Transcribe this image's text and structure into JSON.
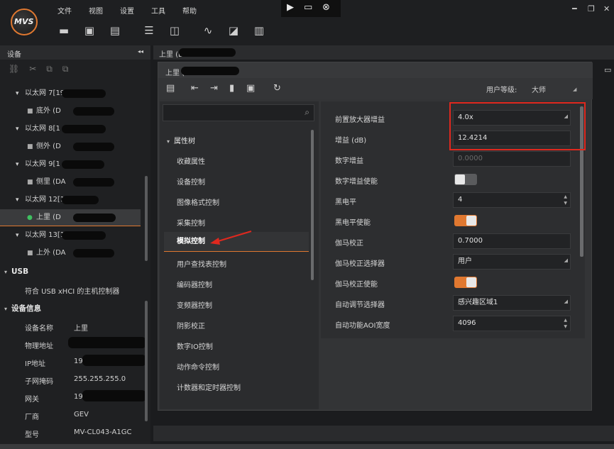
{
  "app": {
    "logo_text": "MVS"
  },
  "menu": [
    "文件",
    "视图",
    "设置",
    "工具",
    "帮助"
  ],
  "left_panel": {
    "title": "设备",
    "collapse_glyph": "◂◂",
    "devices": [
      {
        "label": "以太网 7[192",
        "level": 0
      },
      {
        "label": "底外 (D",
        "level": 1
      },
      {
        "label": "以太网 8[1",
        "level": 0
      },
      {
        "label": "侧外 (D",
        "level": 1
      },
      {
        "label": "以太网 9[1",
        "level": 0
      },
      {
        "label": "侧里 (DA",
        "level": 1
      },
      {
        "label": "以太网 12[192",
        "level": 0
      },
      {
        "label": "上里 (D",
        "level": 1,
        "selected": true
      },
      {
        "label": "以太网 13[1",
        "level": 0
      },
      {
        "label": "上外 (DA",
        "level": 1
      }
    ],
    "usb_header": "USB",
    "usb_item": "符合 USB xHCI 的主机控制器",
    "info_header": "设备信息",
    "info": [
      {
        "k": "设备名称",
        "v": "上里"
      },
      {
        "k": "物理地址",
        "v": ""
      },
      {
        "k": "IP地址",
        "v": "19"
      },
      {
        "k": "子网掩码",
        "v": "255.255.255.0"
      },
      {
        "k": "网关",
        "v": "19"
      },
      {
        "k": "厂商",
        "v": "GEV"
      },
      {
        "k": "型号",
        "v": "MV-CL043-A1GC"
      }
    ]
  },
  "main_tab": {
    "title": "上里 (D"
  },
  "dialog": {
    "title": "上里 (",
    "user_level_label": "用户等级:",
    "user_level_value": "大师",
    "tree_root": "属性树",
    "tree_items": [
      "收藏属性",
      "设备控制",
      "图像格式控制",
      "采集控制",
      "模拟控制",
      "用户查找表控制",
      "编码器控制",
      "变频器控制",
      "阴影校正",
      "数字IO控制",
      "动作命令控制",
      "计数器和定时器控制"
    ],
    "selected_tree_item": "模拟控制",
    "params": [
      {
        "label": "前置放大器增益",
        "type": "dropdown",
        "value": "4.0x"
      },
      {
        "label": "增益 (dB)",
        "type": "text",
        "value": "12.4214"
      },
      {
        "label": "数字增益",
        "type": "disabled",
        "value": "0.0000"
      },
      {
        "label": "数字增益使能",
        "type": "toggle",
        "value": "off"
      },
      {
        "label": "黑电平",
        "type": "spin",
        "value": "4"
      },
      {
        "label": "黑电平使能",
        "type": "toggle",
        "value": "on"
      },
      {
        "label": "伽马校正",
        "type": "text",
        "value": "0.7000"
      },
      {
        "label": "伽马校正选择器",
        "type": "dropdown",
        "value": "用户"
      },
      {
        "label": "伽马校正使能",
        "type": "toggle",
        "value": "on"
      },
      {
        "label": "自动调节选择器",
        "type": "dropdown",
        "value": "感兴趣区域1"
      },
      {
        "label": "自动功能AOI宽度",
        "type": "spin",
        "value": "4096"
      }
    ]
  },
  "colors": {
    "accent": "#e07830",
    "highlight": "#e0281e",
    "selection": "#3a3b3d"
  }
}
